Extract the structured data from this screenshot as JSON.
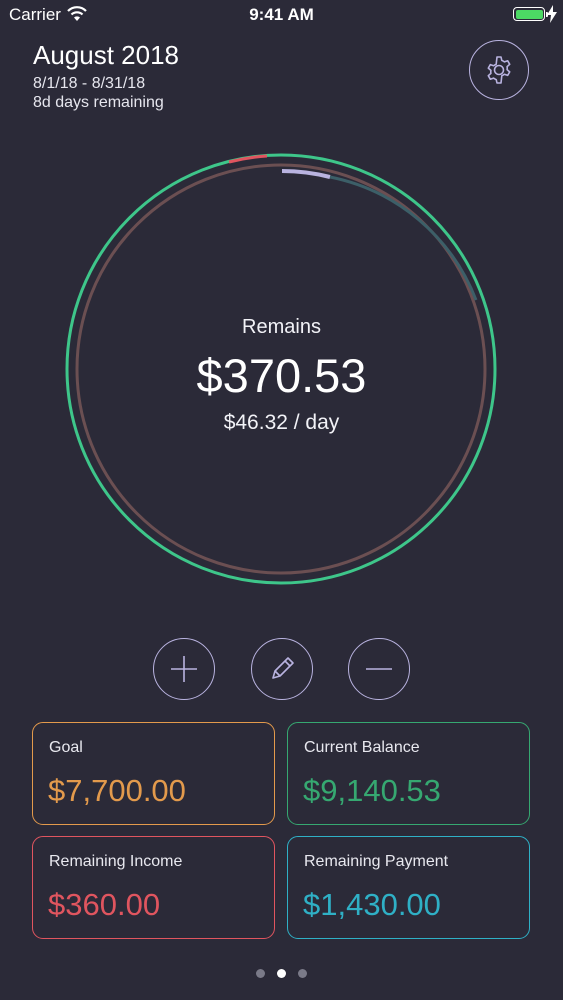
{
  "status_bar": {
    "carrier": "Carrier",
    "time": "9:41 AM",
    "battery_level": 1.0
  },
  "header": {
    "month": "August 2018",
    "date_range": "8/1/18 - 8/31/18",
    "days_remaining": "8d days remaining"
  },
  "summary": {
    "label": "Remains",
    "amount": "$370.53",
    "per_day": "$46.32 / day"
  },
  "cards": {
    "goal": {
      "title": "Goal",
      "value": "$7,700.00",
      "color": "#e39a4c"
    },
    "current_balance": {
      "title": "Current Balance",
      "value": "$9,140.53",
      "color": "#36a871"
    },
    "remaining_income": {
      "title": "Remaining Income",
      "value": "$360.00",
      "color": "#e0555f"
    },
    "remaining_payment": {
      "title": "Remaining Payment",
      "value": "$1,430.00",
      "color": "#2fb0c6"
    }
  },
  "page_indicator": {
    "count": 3,
    "active": 1
  },
  "colors": {
    "background": "#2b2a38",
    "ring_outer": "#3ec68a",
    "ring_inner": "#6b4f52",
    "accent_purple": "#b9b3e0",
    "accent_red": "#e0555f"
  },
  "icons": {
    "settings": "gear-icon",
    "add": "plus-icon",
    "edit": "pencil-icon",
    "subtract": "minus-icon"
  }
}
